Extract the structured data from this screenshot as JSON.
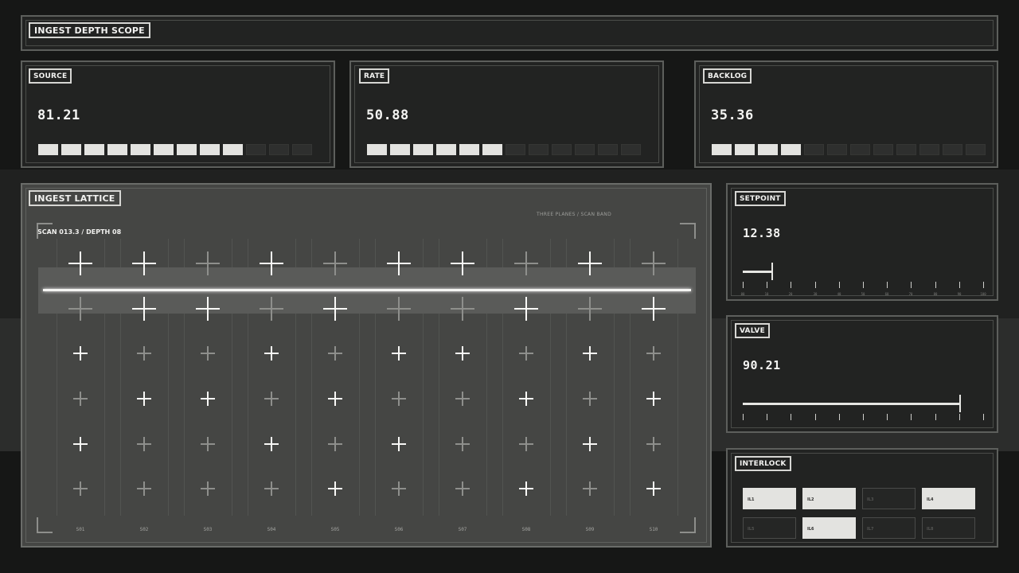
{
  "header": {
    "title": "INGEST DEPTH SCOPE"
  },
  "metrics": [
    {
      "id": "source",
      "label": "SOURCE",
      "value": "81.21",
      "segments_total": 12,
      "segments_on": 9
    },
    {
      "id": "rate",
      "label": "RATE",
      "value": "50.88",
      "segments_total": 12,
      "segments_on": 6
    },
    {
      "id": "backlog",
      "label": "BACKLOG",
      "value": "35.36",
      "segments_total": 12,
      "segments_on": 4
    }
  ],
  "lattice": {
    "title": "INGEST LATTICE",
    "caption": "THREE PLANES / SCAN BAND",
    "scan": "SCAN 013.3 / DEPTH 08",
    "columns": [
      "S01",
      "S02",
      "S03",
      "S04",
      "S05",
      "S06",
      "S07",
      "S08",
      "S09",
      "S10"
    ],
    "scan_rows": [
      [
        1,
        1,
        0,
        1,
        0,
        1,
        1,
        0,
        1,
        0
      ],
      [
        0,
        1,
        1,
        0,
        1,
        0,
        0,
        1,
        0,
        1
      ]
    ],
    "grid_rows": [
      [
        1,
        0,
        0,
        1,
        0,
        1,
        1,
        0,
        1,
        0
      ],
      [
        0,
        1,
        1,
        0,
        1,
        0,
        0,
        1,
        0,
        1
      ],
      [
        1,
        0,
        0,
        1,
        0,
        1,
        0,
        0,
        1,
        0
      ],
      [
        0,
        0,
        0,
        0,
        1,
        0,
        0,
        1,
        0,
        1
      ]
    ]
  },
  "setpoint": {
    "label": "SETPOINT",
    "value": "12.38",
    "fraction": 0.12,
    "ticks": [
      "00",
      "10",
      "20",
      "30",
      "40",
      "50",
      "60",
      "70",
      "80",
      "90",
      "100"
    ]
  },
  "valve": {
    "label": "VALVE",
    "value": "90.21",
    "fraction": 0.9,
    "ticks": [
      "",
      "",
      "",
      "",
      "",
      "",
      "",
      "",
      "",
      "",
      ""
    ]
  },
  "interlock": {
    "label": "INTERLOCK",
    "items": [
      {
        "label": "IL1",
        "on": true
      },
      {
        "label": "IL2",
        "on": true
      },
      {
        "label": "IL3",
        "on": false
      },
      {
        "label": "IL4",
        "on": true
      },
      {
        "label": "IL5",
        "on": false
      },
      {
        "label": "IL6",
        "on": true
      },
      {
        "label": "IL7",
        "on": false
      },
      {
        "label": "IL8",
        "on": false
      }
    ]
  },
  "colors": {
    "background": "#161716",
    "panel": "#222322",
    "accent": "#e3e3e0",
    "lattice": "#454644"
  }
}
